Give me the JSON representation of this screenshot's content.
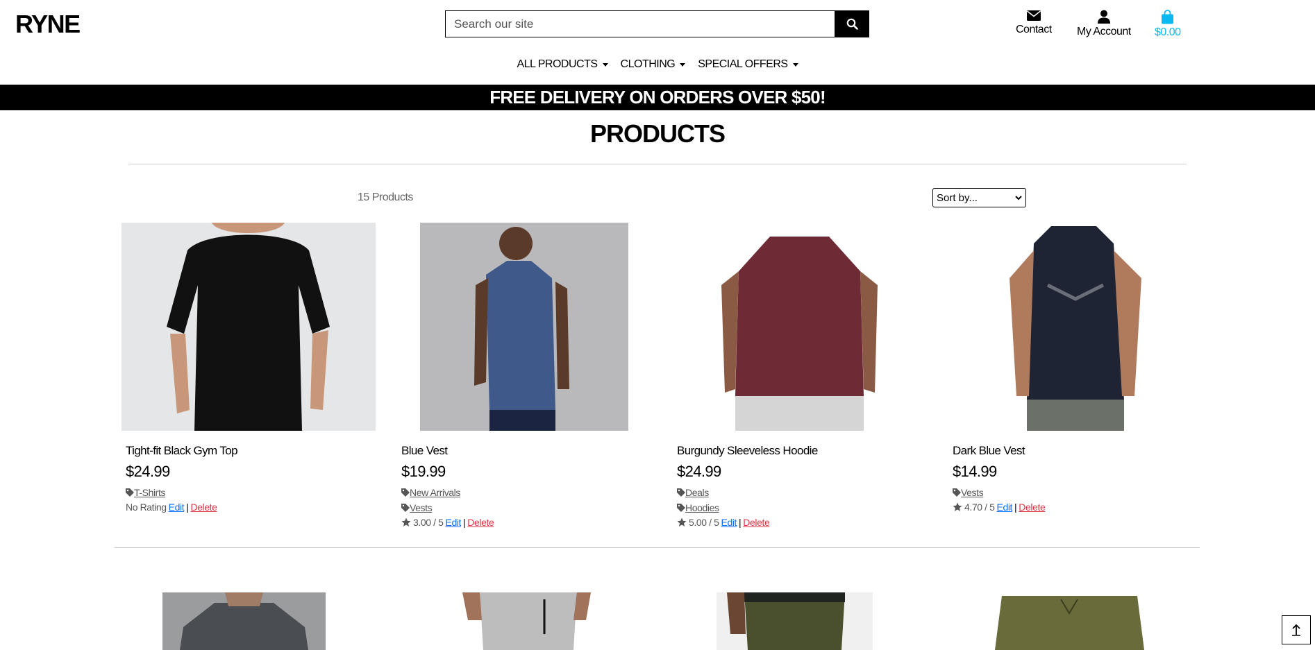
{
  "header": {
    "logo": "RYNE",
    "search_placeholder": "Search our site",
    "contact_label": "Contact",
    "account_label": "My Account",
    "cart_total": "$0.00"
  },
  "nav": [
    {
      "label": "ALL PRODUCTS"
    },
    {
      "label": "CLOTHING"
    },
    {
      "label": "SPECIAL OFFERS"
    }
  ],
  "banner": "FREE DELIVERY ON ORDERS OVER $50!",
  "page_title": "PRODUCTS",
  "product_count": "15 Products",
  "sort_label": "Sort by...",
  "products": [
    {
      "name": "Tight-fit Black Gym Top",
      "price": "$24.99",
      "tags": [
        "T-Shirts"
      ],
      "rating": "No Rating",
      "edit": "Edit",
      "delete": "Delete"
    },
    {
      "name": "Blue Vest",
      "price": "$19.99",
      "tags": [
        "New Arrivals",
        "Vests"
      ],
      "rating": "3.00 / 5",
      "edit": "Edit",
      "delete": "Delete"
    },
    {
      "name": "Burgundy Sleeveless Hoodie",
      "price": "$24.99",
      "tags": [
        "Deals",
        "Hoodies"
      ],
      "rating": "5.00 / 5",
      "edit": "Edit",
      "delete": "Delete"
    },
    {
      "name": "Dark Blue Vest",
      "price": "$14.99",
      "tags": [
        "Vests"
      ],
      "rating": "4.70 / 5",
      "edit": "Edit",
      "delete": "Delete"
    }
  ],
  "colors": {
    "accent_cart": "#0ab9f0",
    "edit_link": "#0d6efd",
    "delete_link": "#dc3545"
  }
}
